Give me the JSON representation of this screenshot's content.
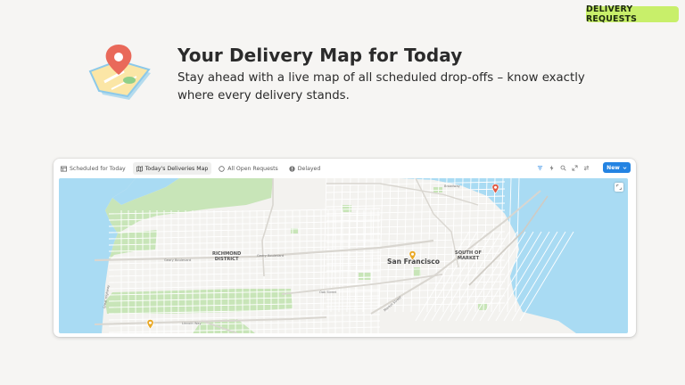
{
  "badge": "DELIVERY REQUESTS",
  "hero": {
    "title": "Your Delivery Map for Today",
    "subtitle": "Stay ahead with a live map of all scheduled drop-offs – know exactly where every delivery stands."
  },
  "toolbar": {
    "tabs": [
      {
        "label": "Scheduled for Today",
        "icon": "table-icon"
      },
      {
        "label": "Today's Deliveries Map",
        "icon": "map-icon",
        "active": true
      },
      {
        "label": "All Open Requests",
        "icon": "circle-icon"
      },
      {
        "label": "Delayed",
        "icon": "alert-icon"
      }
    ],
    "tools": [
      "filter-icon",
      "lightning-icon",
      "search-icon",
      "expand-icon",
      "sort-icon"
    ],
    "new_label": "New"
  },
  "map": {
    "labels": {
      "richmond": "RICHMOND\nDISTRICT",
      "sf": "San Francisco",
      "soma": "SOUTH OF\nMARKET",
      "geary": "Geary Boulevard",
      "geary2": "Geary Boulevard",
      "lincoln": "Lincoln Way",
      "oak": "Oak Street",
      "market": "Market Street",
      "great_hwy": "Great Highway",
      "broadway": "Broadway"
    }
  },
  "colors": {
    "badge": "#c8ef6a",
    "accent": "#2383e2",
    "water": "#a9dbf3",
    "park": "#c8e5b8",
    "land": "#f3f2ef",
    "pin_yellow": "#e9a825",
    "pin_red": "#e05a44"
  }
}
